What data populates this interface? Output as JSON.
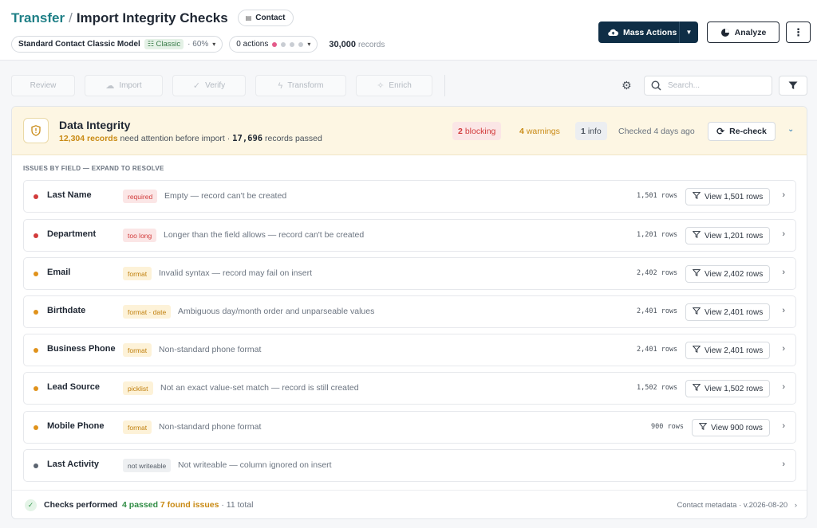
{
  "header": {
    "crumb": "Transfer",
    "sep": "/",
    "title": "Import Integrity Checks",
    "entity_chip": "Contact",
    "model": "Standard Contact Classic Model",
    "model_tag": "Classic",
    "model_pct": "· 60%",
    "actions_label": "0 actions",
    "records_count": "30,000",
    "records_label": "records",
    "mass_actions_label": "Mass Actions",
    "analyze_label": "Analyze"
  },
  "toolbar": {
    "steps": [
      "Review",
      "Import",
      "Verify",
      "Transform",
      "Enrich"
    ],
    "search_placeholder": "Search..."
  },
  "banner": {
    "title": "Data Integrity",
    "records_attention": "12,304 records",
    "attention_text": "need attention before import ·",
    "passed_count": "17,696",
    "passed_text": "records passed",
    "blocking_count": "2",
    "blocking_label": "blocking",
    "warnings_count": "4",
    "warnings_label": "warnings",
    "info_count": "1",
    "info_label": "info",
    "checked": "Checked 4 days ago",
    "recheck_label": "Re-check"
  },
  "issues_heading": "ISSUES BY FIELD — EXPAND TO RESOLVE",
  "issues": [
    {
      "name": "Last Name",
      "tag": "required",
      "severity": "blocking",
      "desc": "Empty — record can't be created",
      "count": "1,501 rows",
      "view": "View 1,501 rows"
    },
    {
      "name": "Department",
      "tag": "too long",
      "severity": "blocking",
      "desc": "Longer than the field allows — record can't be created",
      "count": "1,201 rows",
      "view": "View 1,201 rows"
    },
    {
      "name": "Email",
      "tag": "format",
      "severity": "warning",
      "desc": "Invalid syntax — record may fail on insert",
      "count": "2,402 rows",
      "view": "View 2,402 rows"
    },
    {
      "name": "Birthdate",
      "tag": "format · date",
      "severity": "warning",
      "desc": "Ambiguous day/month order and unparseable values",
      "count": "2,401 rows",
      "view": "View 2,401 rows"
    },
    {
      "name": "Business Phone",
      "tag": "format",
      "severity": "warning",
      "desc": "Non-standard phone format",
      "count": "2,401 rows",
      "view": "View 2,401 rows"
    },
    {
      "name": "Lead Source",
      "tag": "picklist",
      "severity": "warning",
      "desc": "Not an exact value-set match — record is still created",
      "count": "1,502 rows",
      "view": "View 1,502 rows"
    },
    {
      "name": "Mobile Phone",
      "tag": "format",
      "severity": "warning",
      "desc": "Non-standard phone format",
      "count": "900 rows",
      "view": "View 900 rows"
    },
    {
      "name": "Last Activity",
      "tag": "not writeable",
      "severity": "info",
      "desc": "Not writeable — column ignored on insert",
      "count": "",
      "view": ""
    }
  ],
  "footer": {
    "label": "Checks performed",
    "passed": "4 passed",
    "found": "7 found issues",
    "total": "· 11 total",
    "meta": "Contact metadata · v.2026-08-20"
  },
  "colors": {
    "accent": "#1e7f86",
    "primary_button": "#0f2e46",
    "blocking": "#d23b3b",
    "warning": "#e0921b",
    "info": "#5b6470",
    "banner_bg": "#fdf6e3"
  }
}
